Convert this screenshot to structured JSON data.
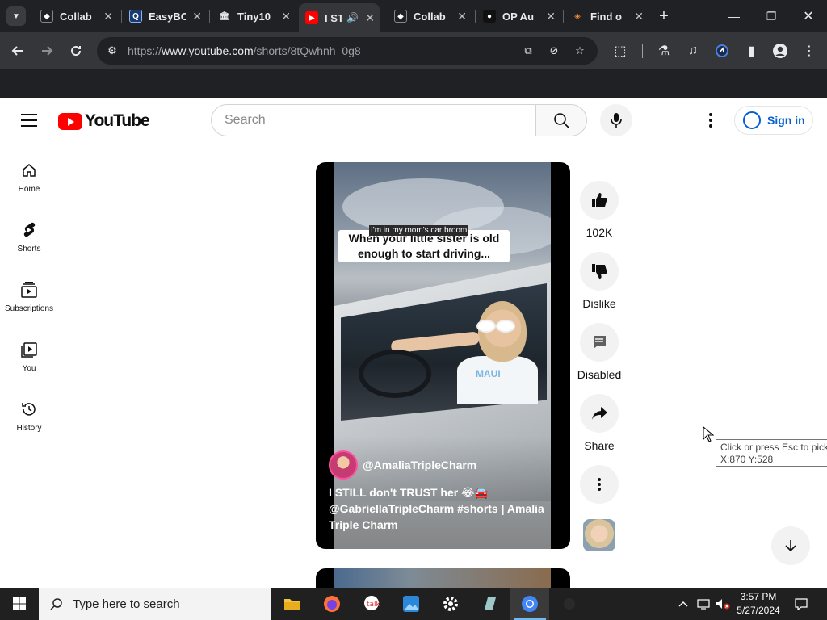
{
  "browser": {
    "tabs": [
      {
        "title": "Collab",
        "favicon": "collab-icon",
        "active": false
      },
      {
        "title": "EasyBC",
        "favicon": "q-icon",
        "active": false
      },
      {
        "title": "Tiny10",
        "favicon": "archive-icon",
        "active": false
      },
      {
        "title": "I ST",
        "favicon": "youtube-icon",
        "active": true
      },
      {
        "title": "Collab",
        "favicon": "collab-icon",
        "active": false
      },
      {
        "title": "OP Au",
        "favicon": "openai-icon",
        "active": false
      },
      {
        "title": "Find o",
        "favicon": "diamond-icon",
        "active": false
      }
    ],
    "url_prefix": "https://",
    "url_domain": "www.youtube.com",
    "url_path": "/shorts/8tQwhnh_0g8"
  },
  "youtube": {
    "logo_text": "YouTube",
    "search_placeholder": "Search",
    "signin_label": "Sign in",
    "guide": [
      {
        "label": "Home",
        "icon": "home-icon"
      },
      {
        "label": "Shorts",
        "icon": "shorts-icon"
      },
      {
        "label": "Subscriptions",
        "icon": "subscriptions-icon"
      },
      {
        "label": "You",
        "icon": "you-icon"
      },
      {
        "label": "History",
        "icon": "history-icon"
      }
    ]
  },
  "short": {
    "overlay_small": "I'm in my mom's car broom",
    "overlay_caption": "When your little sister is old enough to start driving...",
    "shirt_text": "MAUI",
    "channel": "@AmaliaTripleCharm",
    "title": "I STILL don't TRUST her 😂🚘 @GabriellaTripleCharm #shorts | Amalia Triple Charm"
  },
  "actions": {
    "like_count": "102K",
    "dislike_label": "Dislike",
    "comments_label": "Disabled",
    "share_label": "Share"
  },
  "tooltip": {
    "line1": "Click or press Esc to pick",
    "line2": "X:870  Y:528"
  },
  "taskbar": {
    "search_placeholder": "Type here to search",
    "time": "3:57 PM",
    "date": "5/27/2024"
  },
  "colors": {
    "yt_red": "#ff0000",
    "link_blue": "#065fd4",
    "chrome_dark": "#202124"
  }
}
